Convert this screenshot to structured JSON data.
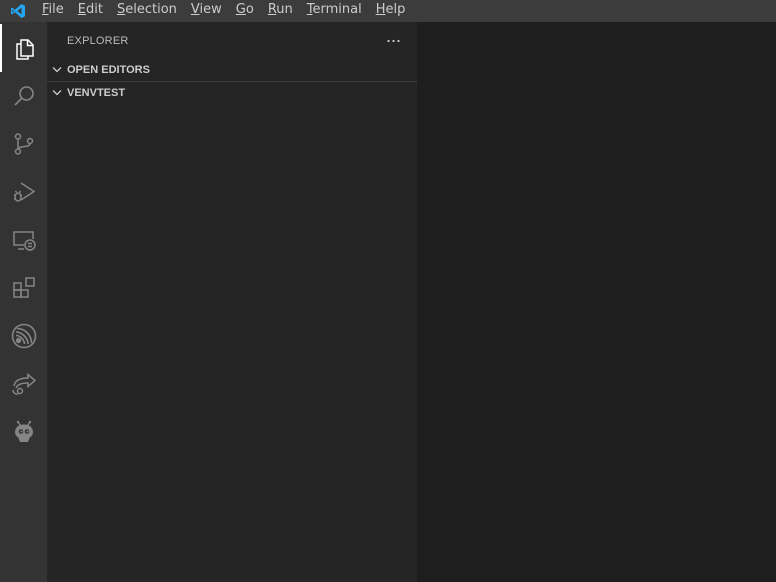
{
  "titlebar": {
    "app_icon": "vscode-logo",
    "menu": [
      {
        "label_rest": "ile",
        "mnemonic": "F"
      },
      {
        "label_rest": "dit",
        "mnemonic": "E"
      },
      {
        "label_rest": "election",
        "mnemonic": "S"
      },
      {
        "label_rest": "iew",
        "mnemonic": "V"
      },
      {
        "label_rest": "o",
        "mnemonic": "G"
      },
      {
        "label_rest": "un",
        "mnemonic": "R"
      },
      {
        "label_rest": "erminal",
        "mnemonic": "T"
      },
      {
        "label_rest": "elp",
        "mnemonic": "H"
      }
    ]
  },
  "activitybar": {
    "items": [
      {
        "icon": "explorer-icon",
        "active": true
      },
      {
        "icon": "search-icon",
        "active": false
      },
      {
        "icon": "source-control-icon",
        "active": false
      },
      {
        "icon": "run-debug-icon",
        "active": false
      },
      {
        "icon": "remote-explorer-icon",
        "active": false
      },
      {
        "icon": "extensions-icon",
        "active": false
      },
      {
        "icon": "espressif-icon",
        "active": false
      },
      {
        "icon": "live-share-icon",
        "active": false
      },
      {
        "icon": "platformio-icon",
        "active": false
      }
    ]
  },
  "sidebar": {
    "title": "EXPLORER",
    "more_icon": "ellipsis-icon",
    "sections": [
      {
        "label": "OPEN EDITORS",
        "expanded": true
      },
      {
        "label": "VENVTEST",
        "expanded": true
      }
    ]
  },
  "colors": {
    "titlebar": "#3c3c3c",
    "activitybar": "#333333",
    "sidebar": "#252526",
    "editor": "#1e1e1e",
    "accent": "#007acc"
  }
}
